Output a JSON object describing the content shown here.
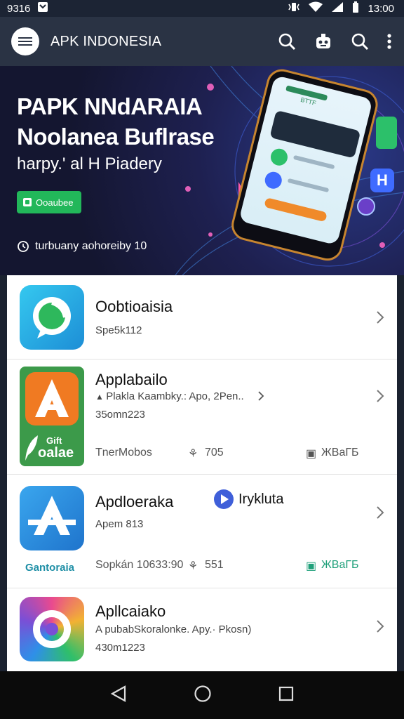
{
  "status": {
    "time_left": "9316",
    "time_right": "13:00"
  },
  "app_bar": {
    "title": "APK INDONESIA"
  },
  "hero": {
    "title_line1": "PAPK NNdARAIA",
    "title_line2": "Noolanea Buflrase",
    "subtitle": "harpy.' al H Piadery",
    "button_label": "Ooaubee",
    "meta_text": "turbuany aohoreiby 10",
    "phone_label": "BTTF"
  },
  "apps": [
    {
      "name": "Oobtioaisia",
      "sub": "Spe5k112"
    },
    {
      "name": "Applabailo",
      "sub": "Plakla Kaambky.: Apo, 2Pen..",
      "meta": "35omn223",
      "icon_label_line1": "Gift",
      "icon_label_line2": "oalae",
      "footer_left": "TnerMobos",
      "footer_mid": "705",
      "footer_right": "ЖBaГБ"
    },
    {
      "name": "Apdloeraka",
      "badge": "Irykluta",
      "sub": "Apem 813",
      "below_icon": "Gantoraia",
      "footer_left": "Sopkán 10633:90",
      "footer_mid": "551",
      "footer_right": "ЖBaГБ"
    },
    {
      "name": "Apllcaiako",
      "sub": "A pubabSkoralonke. Apy.· Pkosn)",
      "meta": "430m1223"
    }
  ],
  "colors": {
    "status_bg": "#1c2434",
    "app_bar_bg": "#2a3344",
    "hero_bg": "#141630",
    "accent_green": "#22b75a",
    "nav_bg": "#0b0b0b"
  }
}
